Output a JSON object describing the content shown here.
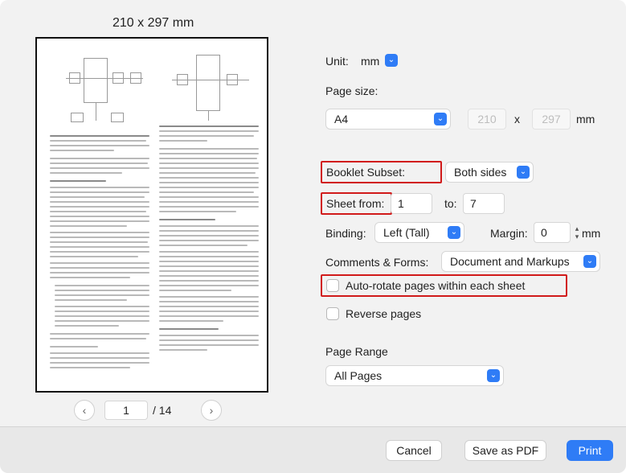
{
  "preview": {
    "paper_size": "210 x 297 mm",
    "prev_icon": "chevron-left-icon",
    "next_icon": "chevron-right-icon",
    "current_page": "1",
    "total_pages": "/ 14"
  },
  "settings": {
    "unit_label": "Unit:",
    "unit_value": "mm",
    "page_size_label": "Page size:",
    "page_size_value": "A4",
    "width_value": "210",
    "x_label": "x",
    "height_value": "297",
    "size_unit": "mm",
    "booklet_subset_label": "Booklet Subset:",
    "booklet_subset_value": "Both sides",
    "sheet_from_label": "Sheet from:",
    "sheet_from_value": "1",
    "sheet_to_label": "to:",
    "sheet_to_value": "7",
    "binding_label": "Binding:",
    "binding_value": "Left (Tall)",
    "margin_label": "Margin:",
    "margin_value": "0",
    "margin_unit": "mm",
    "comments_label": "Comments & Forms:",
    "comments_value": "Document and Markups",
    "auto_rotate_label": "Auto-rotate pages within each sheet",
    "reverse_label": "Reverse pages",
    "page_range_label": "Page Range",
    "page_range_value": "All Pages"
  },
  "footer": {
    "cancel_label": "Cancel",
    "save_pdf_label": "Save as PDF",
    "print_label": "Print"
  },
  "colors": {
    "accent": "#2f7cf6",
    "highlight": "#d11a1a"
  }
}
